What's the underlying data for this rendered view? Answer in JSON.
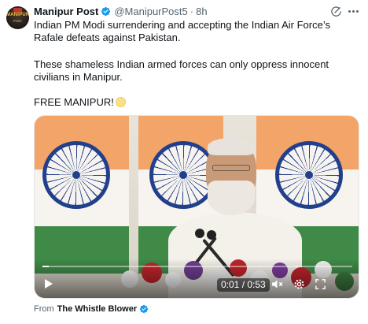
{
  "post": {
    "author_name": "Manipur Post",
    "handle": "@ManipurPost5",
    "separator": "·",
    "time": "8h",
    "avatar_text": "MANIPUR",
    "avatar_subtext": "POST",
    "text_line_1": "Indian PM Modi surrendering and accepting the Indian Air Force’s Rafale defeats against Pakistan.",
    "text_line_2": "These shameless Indian armed forces can only oppress innocent civilians in Manipur.",
    "text_line_3": "FREE MANIPUR!",
    "emoji_icon": "clapping-hands-emoji",
    "verified_color": "#1d9bf0"
  },
  "video": {
    "timecode": "0:01 / 0:53",
    "progress": 0.02,
    "controls": [
      "play-icon",
      "mute-icon",
      "settings-icon",
      "fullscreen-icon"
    ]
  },
  "source": {
    "label": "From",
    "name": "The Whistle Blower"
  }
}
